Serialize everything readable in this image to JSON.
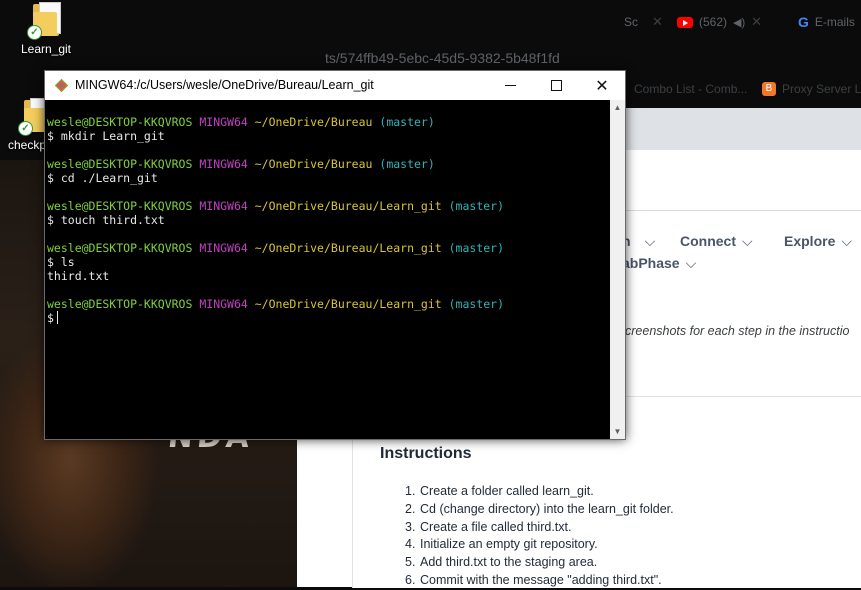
{
  "desktop": {
    "icon1_label": "Learn_git",
    "icon2_label": "checkp",
    "wallpaper_text": "NDA"
  },
  "browser": {
    "tabs": [
      {
        "label": "Sc",
        "close": "✕"
      },
      {
        "label": "(562)",
        "close": "✕"
      },
      {
        "label": "E-mails"
      }
    ],
    "url": "ts/574ffb49-5ebc-45d5-9382-5b48f1fd",
    "bookmarks": [
      "Combo List - Comb...",
      "Proxy Server L"
    ],
    "nav": [
      "n",
      "Connect",
      "Explore",
      "abPhase"
    ],
    "hint": "creenshots for each step in the instructio",
    "instructions_title": "Instructions",
    "steps": [
      {
        "num": "1.",
        "text": "Create a folder called learn_git."
      },
      {
        "num": "2.",
        "text": "Cd (change directory) into the learn_git folder."
      },
      {
        "num": "3.",
        "text": "Create a file called third.txt."
      },
      {
        "num": "4.",
        "text": "Initialize an empty git repository."
      },
      {
        "num": "5.",
        "text": "Add third.txt to the staging area."
      },
      {
        "num": "6.",
        "text": "Commit with the message \"adding third.txt\"."
      }
    ]
  },
  "terminal": {
    "title": "MINGW64:/c/Users/wesle/OneDrive/Bureau/Learn_git",
    "user": "wesle@DESKTOP-KKQVROS",
    "env": "MINGW64",
    "blocks": [
      {
        "path": "~/OneDrive/Bureau",
        "branch": "(master)",
        "cmd": "$ mkdir Learn_git",
        "output": ""
      },
      {
        "path": "~/OneDrive/Bureau",
        "branch": "(master)",
        "cmd": "$ cd ./Learn_git",
        "output": ""
      },
      {
        "path": "~/OneDrive/Bureau/Learn_git",
        "branch": "(master)",
        "cmd": "$ touch third.txt",
        "output": ""
      },
      {
        "path": "~/OneDrive/Bureau/Learn_git",
        "branch": "(master)",
        "cmd": "$ ls",
        "output": "third.txt"
      },
      {
        "path": "~/OneDrive/Bureau/Learn_git",
        "branch": "(master)",
        "cmd": "$",
        "output": ""
      }
    ],
    "colors": {
      "user": "#7fd13b",
      "env": "#c040c0",
      "path": "#d8c531",
      "branch": "#2fb3b8"
    }
  }
}
